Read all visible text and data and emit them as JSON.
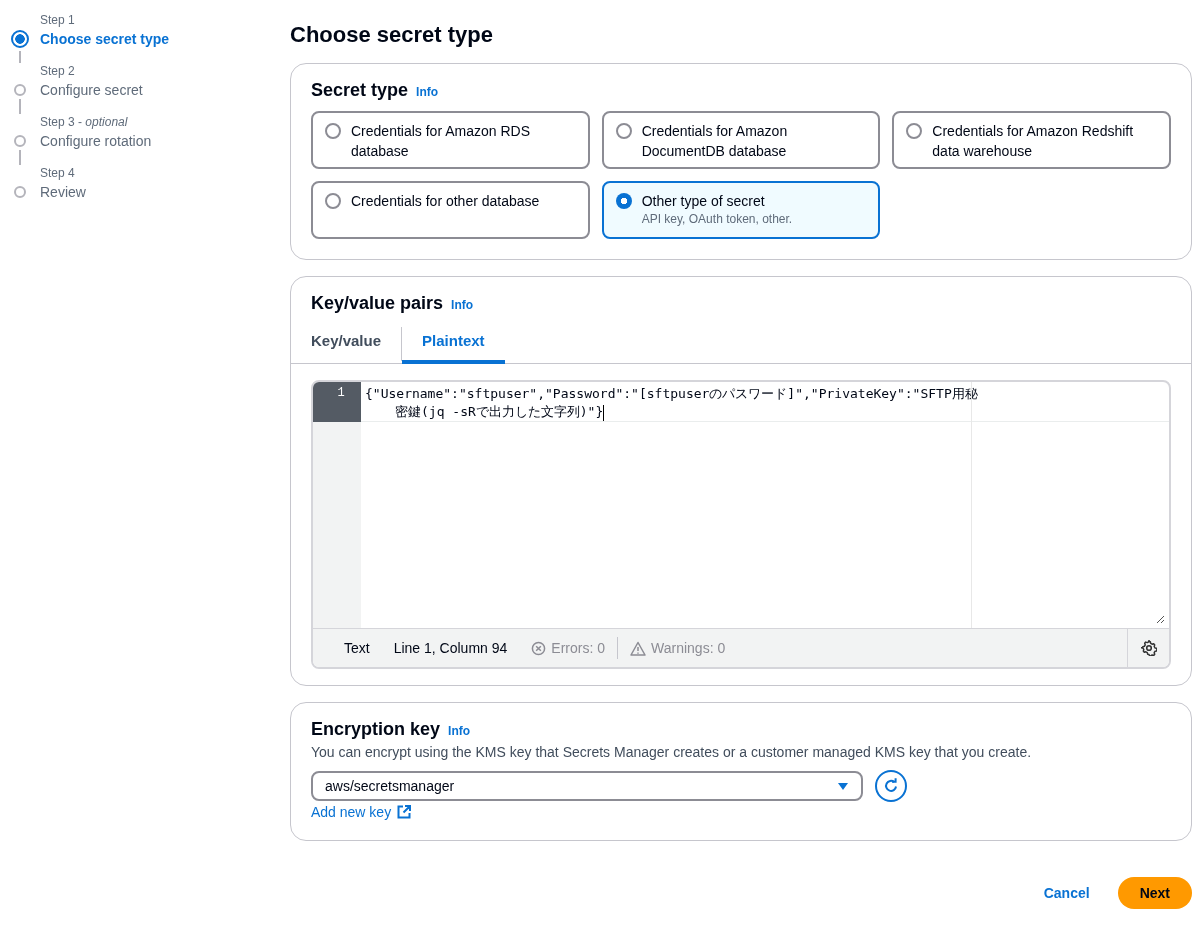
{
  "steps": [
    {
      "label": "Step 1",
      "title": "Choose secret type",
      "selected": true
    },
    {
      "label": "Step 2",
      "title": "Configure secret",
      "selected": false
    },
    {
      "label": "Step 3 - *optional*",
      "title": "Configure rotation",
      "selected": false
    },
    {
      "label": "Step 4",
      "title": "Review",
      "selected": false
    }
  ],
  "page_title": "Choose secret type",
  "secret_type": {
    "title": "Secret type",
    "info": "Info",
    "options": [
      {
        "title": "Credentials for Amazon RDS database",
        "selected": false
      },
      {
        "title": "Credentials for Amazon DocumentDB database",
        "selected": false
      },
      {
        "title": "Credentials for Amazon Redshift data warehouse",
        "selected": false
      },
      {
        "title": "Credentials for other database",
        "selected": false
      },
      {
        "title": "Other type of secret",
        "description": "API key, OAuth token, other.",
        "selected": true
      }
    ]
  },
  "key_value": {
    "title": "Key/value pairs",
    "info": "Info",
    "tabs": [
      {
        "label": "Key/value",
        "selected": false
      },
      {
        "label": "Plaintext",
        "selected": true
      }
    ],
    "editor": {
      "lines": [
        {
          "number": "1",
          "text": "{\"Username\":\"sftpuser\",\"Password\":\"[sftpuserのパスワード]\",\"PrivateKey\":\"SFTP用秘密鍵(jq -sRで出力した文字列)\"}"
        }
      ],
      "status": {
        "mode": "Text",
        "position": "Line 1, Column 94",
        "errors": "Errors: 0",
        "warnings": "Warnings: 0"
      }
    }
  },
  "encryption": {
    "title": "Encryption key",
    "info": "Info",
    "description": "You can encrypt using the KMS key that Secrets Manager creates or a customer managed KMS key that you create.",
    "value": "aws/secretsmanager",
    "link": "Add new key"
  },
  "buttons": {
    "cancel": "Cancel",
    "next": "Next"
  }
}
